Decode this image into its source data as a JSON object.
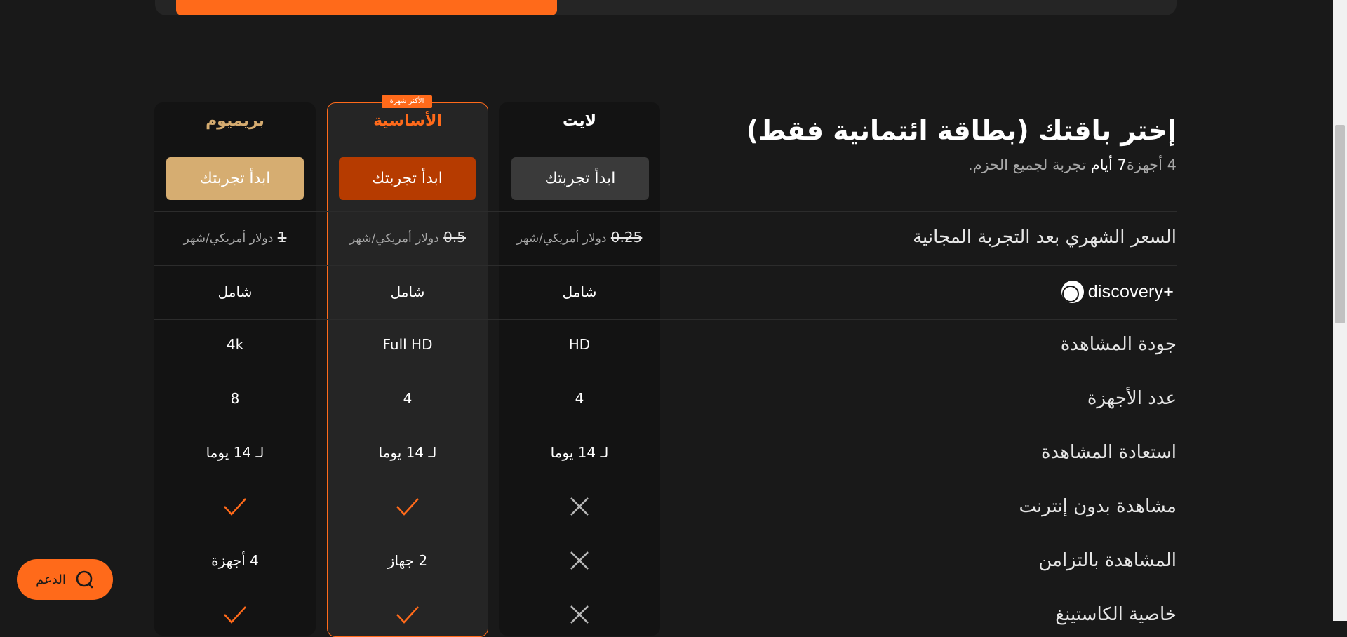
{
  "heading": {
    "title": "إختر باقتك (بطاقة ائتمانية فقط)",
    "subtitle_pre": "4 أجهزة",
    "subtitle_strong": "7 أيام",
    "subtitle_post": " تجربة لجميع الحزم."
  },
  "badge": "الأكثر شهرة",
  "plans": {
    "lite": {
      "name": "لايت",
      "cta": "ابدأ تجربتك",
      "price_old": "0.25",
      "price_unit": "دولار أمريكي/شهر"
    },
    "basic": {
      "name": "الأساسية",
      "cta": "ابدأ تجربتك",
      "price_old": "0.5",
      "price_unit": "دولار أمريكي/شهر"
    },
    "premium": {
      "name": "بريميوم",
      "cta": "ابدأ تجربتك",
      "price_old": "1",
      "price_unit": "دولار أمريكي/شهر"
    }
  },
  "rows": {
    "price": {
      "label": "السعر الشهري بعد التجربة المجانية"
    },
    "discovery": {
      "label": "discovery+",
      "lite": "شامل",
      "basic": "شامل",
      "premium": "شامل"
    },
    "quality": {
      "label": "جودة المشاهدة",
      "lite": "HD",
      "basic": "Full HD",
      "premium": "4k"
    },
    "devices": {
      "label": "عدد الأجهزة",
      "lite": "4",
      "basic": "4",
      "premium": "8"
    },
    "catchup": {
      "label": "استعادة المشاهدة",
      "lite": "لـ 14 يوما",
      "basic": "لـ 14 يوما",
      "premium": "لـ 14 يوما"
    },
    "offline": {
      "label": "مشاهدة بدون إنترنت",
      "lite": "cross-icon",
      "basic": "check-icon",
      "premium": "check-icon"
    },
    "concurrent": {
      "label": "المشاهدة بالتزامن",
      "lite": "cross-icon",
      "basic": "2 جهاز",
      "premium": "4 أجهزة"
    },
    "casting": {
      "label": "خاصية الكاستينغ",
      "lite": "cross-icon",
      "basic": "check-icon",
      "premium": "check-icon"
    }
  },
  "support": {
    "label": "الدعم",
    "icon": "chat-icon"
  },
  "colors": {
    "accent": "#ff6a1a",
    "premium": "#d6ac70",
    "background": "#191919"
  }
}
